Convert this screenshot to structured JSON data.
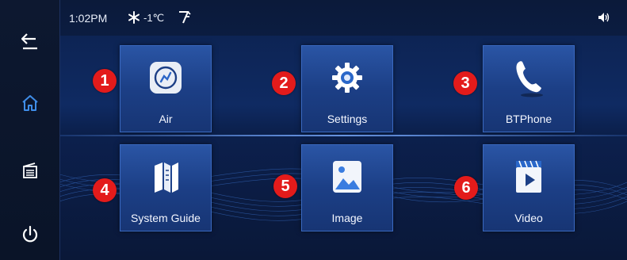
{
  "status": {
    "time": "1:02PM",
    "temperature": "-1℃"
  },
  "rail": {
    "items": [
      {
        "name": "back",
        "icon": "back-icon"
      },
      {
        "name": "home",
        "icon": "home-icon"
      },
      {
        "name": "radio",
        "icon": "radio-icon"
      },
      {
        "name": "power",
        "icon": "power-icon"
      }
    ]
  },
  "tiles": [
    {
      "label": "Air",
      "badge": "1",
      "icon": "air-icon"
    },
    {
      "label": "Settings",
      "badge": "2",
      "icon": "gear-icon"
    },
    {
      "label": "BTPhone",
      "badge": "3",
      "icon": "phone-icon"
    },
    {
      "label": "System Guide",
      "badge": "4",
      "icon": "map-guide-icon"
    },
    {
      "label": "Image",
      "badge": "5",
      "icon": "image-icon"
    },
    {
      "label": "Video",
      "badge": "6",
      "icon": "video-icon"
    }
  ],
  "colors": {
    "accent": "#4a8fe8",
    "badge": "#e31b1b",
    "tile": "#1f4590"
  }
}
